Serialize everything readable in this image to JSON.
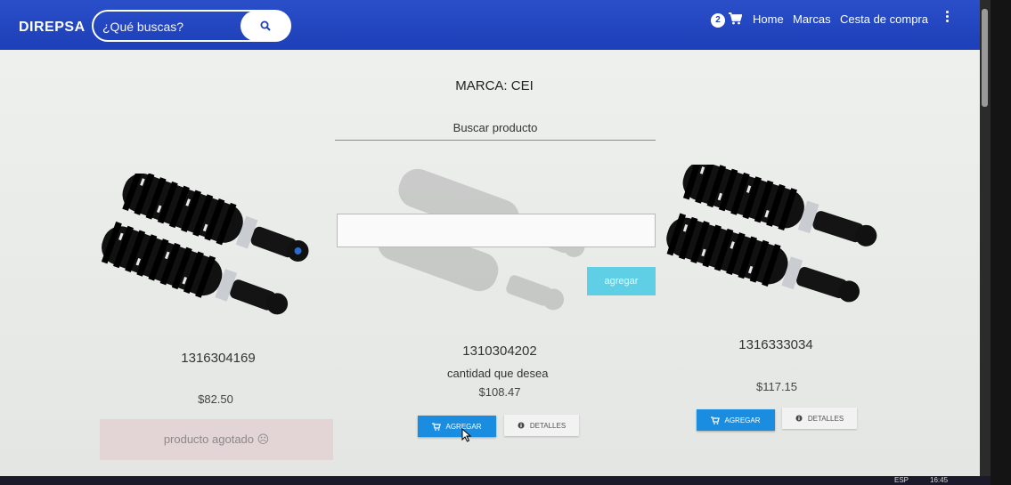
{
  "header": {
    "brand": "DIREPSA",
    "search": {
      "placeholder": "¿Qué buscas?",
      "button_icon": "search-icon"
    },
    "cart_count": "2",
    "cart_icon": "cart-icon",
    "nav": [
      "Home",
      "Marcas",
      "Cesta de compra"
    ],
    "menu_icon": "kebab-menu-icon",
    "color": "#1d3fb8"
  },
  "page": {
    "title": "MARCA: CEI",
    "filter_placeholder": "Buscar producto"
  },
  "modal": {
    "quantity_label": "cantidad que desea",
    "quantity_value": "",
    "submit_label": "agregar"
  },
  "products": [
    {
      "sku": "1316304169",
      "price": "$82.50",
      "status": "producto agotado ☹"
    },
    {
      "sku": "1310304202",
      "price": "$108.47",
      "add_label": "AGREGAR",
      "details_label": "DETALLES"
    },
    {
      "sku": "1316333034",
      "price": "$117.15",
      "add_label": "AGREGAR",
      "details_label": "DETALLES"
    }
  ],
  "taskbar": {
    "lang": "ESP",
    "time": "16:45"
  },
  "colors": {
    "accent": "#1a8de0",
    "nav": "#1d3fb8",
    "out_of_stock_bg": "#e3d4d5",
    "modal_button": "#5fcfe6"
  }
}
